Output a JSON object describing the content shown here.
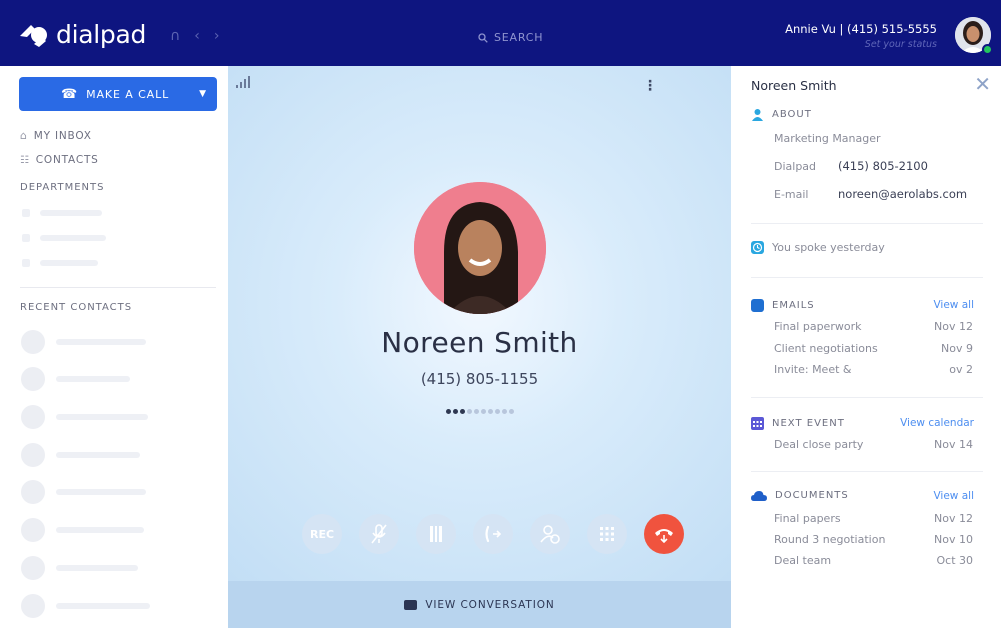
{
  "topbar": {
    "brand": "dialpad",
    "search_label": "SEARCH",
    "user_line": "Annie Vu | (415) 515-5555",
    "user_status_placeholder": "Set your status",
    "brand_color": "#0e1580"
  },
  "sidebar": {
    "make_call_label": "MAKE A CALL",
    "inbox_label": "MY INBOX",
    "contacts_label": "CONTACTS",
    "departments_label": "DEPARTMENTS",
    "recent_label": "RECENT CONTACTS"
  },
  "call": {
    "name": "Noreen Smith",
    "number": "(415) 805-1155",
    "controls": [
      {
        "icon": "rec-icon",
        "label": "REC"
      },
      {
        "icon": "mute-icon"
      },
      {
        "icon": "hold-icon"
      },
      {
        "icon": "transfer-icon"
      },
      {
        "icon": "add-caller-icon"
      },
      {
        "icon": "keypad-icon"
      },
      {
        "icon": "hangup-icon"
      }
    ],
    "view_conversation_label": "VIEW CONVERSATION",
    "hangup_color": "#f0533e"
  },
  "panel": {
    "title": "Noreen Smith",
    "about_label": "ABOUT",
    "job_title": "Marketing Manager",
    "dialpad_key": "Dialpad",
    "dialpad_value": "(415) 805-2100",
    "email_key": "E-mail",
    "email_value": "noreen@aerolabs.com",
    "last_spoke": "You spoke yesterday",
    "emails_label": "EMAILS",
    "emails_link": "View all",
    "emails": [
      {
        "subject": "Final paperwork",
        "date": "Nov 12"
      },
      {
        "subject": "Client negotiations",
        "date": "Nov 9"
      },
      {
        "subject": "Invite: Meet &",
        "date": "ov 2"
      }
    ],
    "event_label": "NEXT EVENT",
    "event_link": "View calendar",
    "event_name": "Deal close party",
    "event_date": "Nov 14",
    "documents_label": "DOCUMENTS",
    "documents_link": "View all",
    "documents": [
      {
        "name": "Final papers",
        "date": "Nov 12"
      },
      {
        "name": "Round 3 negotiation",
        "date": "Nov 10"
      },
      {
        "name": "Deal team",
        "date": "Oct 30"
      }
    ]
  }
}
